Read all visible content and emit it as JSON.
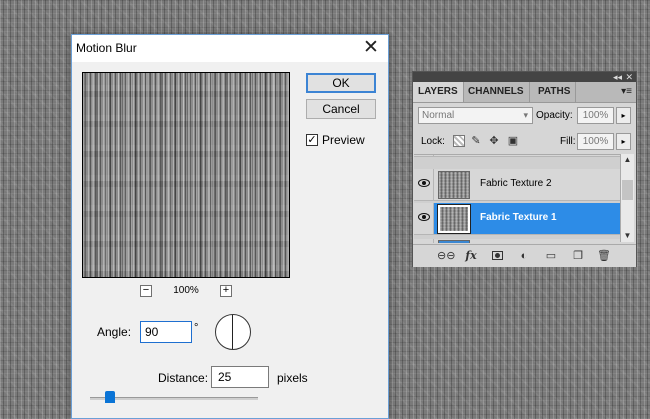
{
  "dialog": {
    "title": "Motion Blur",
    "ok_label": "OK",
    "cancel_label": "Cancel",
    "preview_label": "Preview",
    "preview_checked": true,
    "zoom_level": "100%",
    "zoom_minus": "−",
    "zoom_plus": "+",
    "angle_label": "Angle:",
    "angle_value": "90",
    "degree_symbol": "°",
    "distance_label": "Distance:",
    "distance_value": "25",
    "distance_unit": "pixels"
  },
  "layers_panel": {
    "tabs": [
      "LAYERS",
      "CHANNELS",
      "PATHS"
    ],
    "active_tab": "LAYERS",
    "blend_mode": "Normal",
    "opacity_label": "Opacity:",
    "opacity_value": "100%",
    "lock_label": "Lock:",
    "fill_label": "Fill:",
    "fill_value": "100%",
    "layers": [
      {
        "name": "Fabric Texture 2",
        "visible": true,
        "selected": false
      },
      {
        "name": "Fabric Texture 1",
        "visible": true,
        "selected": true
      }
    ]
  },
  "colors": {
    "accent": "#3c84d4",
    "selection": "#2d8ce7",
    "slider_thumb": "#0a74d6"
  }
}
